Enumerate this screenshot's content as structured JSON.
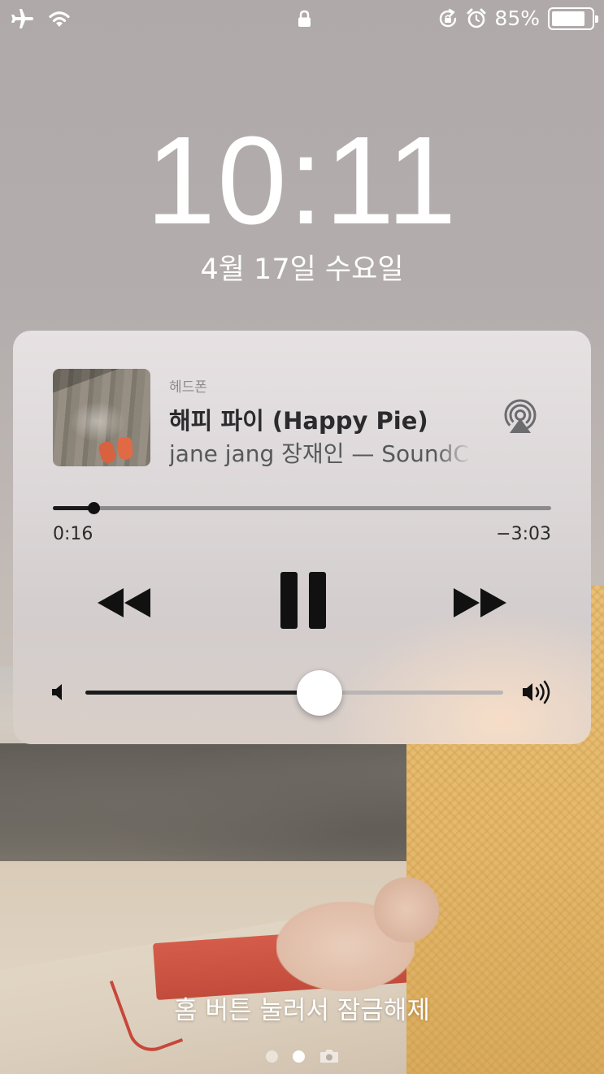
{
  "status_bar": {
    "icons": [
      "airplane-mode-icon",
      "wifi-icon",
      "lock-icon",
      "rotation-lock-icon",
      "alarm-icon",
      "battery-icon"
    ],
    "battery_percent": "85%",
    "battery_level": 0.85
  },
  "lock_screen": {
    "time": "10:11",
    "date": "4월 17일 수요일",
    "unlock_hint": "홈 버튼 눌러서 잠금해제",
    "page_dots": {
      "count": 2,
      "active_index": 1,
      "trailing_icon": "camera-icon"
    }
  },
  "now_playing": {
    "output_device": "헤드폰",
    "title": "해피 파이 (Happy Pie)",
    "artist": "jane jang 장재인 — SoundCloud",
    "elapsed": "0:16",
    "remaining": "−3:03",
    "progress": 0.081,
    "volume": 0.56,
    "icons": {
      "airplay": "airplay-icon",
      "rewind": "rewind-icon",
      "pause": "pause-icon",
      "forward": "fast-forward-icon",
      "volume_min": "volume-min-icon",
      "volume_max": "volume-max-icon"
    }
  },
  "colors": {
    "widget_text": "#2b2b2d",
    "secondary_text": "#57585a",
    "track_fill": "#1a1a1c"
  }
}
